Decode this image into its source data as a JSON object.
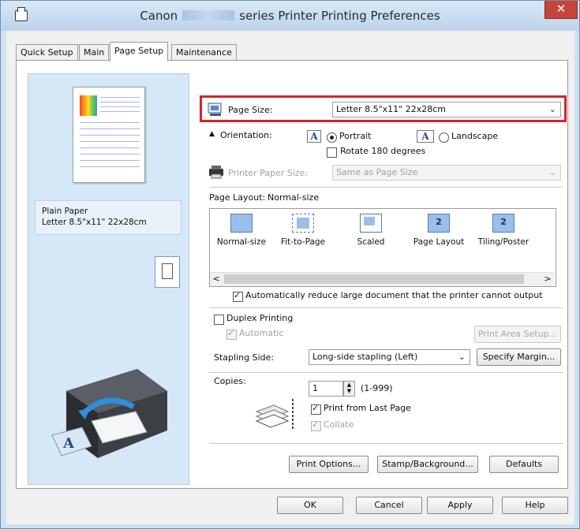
{
  "window": {
    "title_prefix": "Canon",
    "title_suffix": "series Printer Printing Preferences",
    "close_glyph": "✕"
  },
  "tabs": [
    {
      "label": "Quick Setup",
      "active": false
    },
    {
      "label": "Main",
      "active": false
    },
    {
      "label": "Page Setup",
      "active": true
    },
    {
      "label": "Maintenance",
      "active": false
    }
  ],
  "preview": {
    "media_type": "Plain Paper",
    "paper_size": "Letter 8.5\"x11\" 22x28cm"
  },
  "page_size": {
    "label": "Page Size:",
    "value": "Letter 8.5\"x11\" 22x28cm",
    "icon": "page-size-icon"
  },
  "orientation": {
    "label": "Orientation:",
    "icon_glyph": "A",
    "portrait_label": "Portrait",
    "landscape_label": "Landscape",
    "selected": "portrait",
    "rotate_label": "Rotate 180 degrees",
    "rotate_checked": false
  },
  "printer_paper_size": {
    "label": "Printer Paper Size:",
    "value": "Same as Page Size",
    "enabled": false
  },
  "page_layout": {
    "label": "Page Layout:",
    "current": "Normal-size",
    "options": [
      {
        "label": "Normal-size",
        "glyph": ""
      },
      {
        "label": "Fit-to-Page",
        "glyph": ""
      },
      {
        "label": "Scaled",
        "glyph": ""
      },
      {
        "label": "Page Layout",
        "glyph": "2"
      },
      {
        "label": "Tiling/Poster",
        "glyph": "2"
      }
    ],
    "scroll_left": "<",
    "scroll_right": ">"
  },
  "auto_reduce": {
    "label": "Automatically reduce large document that the printer cannot output",
    "checked": true
  },
  "duplex": {
    "label": "Duplex Printing",
    "checked": false,
    "automatic_label": "Automatic",
    "automatic_checked": true,
    "print_area_button": "Print Area Setup..."
  },
  "stapling": {
    "label": "Stapling Side:",
    "value": "Long-side stapling (Left)",
    "margin_button": "Specify Margin..."
  },
  "copies": {
    "label": "Copies:",
    "value": "1",
    "range": "(1-999)",
    "last_page_label": "Print from Last Page",
    "last_page_checked": true,
    "collate_label": "Collate",
    "collate_checked": true
  },
  "panel_buttons": {
    "print_options": "Print Options...",
    "stamp_background": "Stamp/Background...",
    "defaults": "Defaults"
  },
  "dialog_buttons": {
    "ok": "OK",
    "cancel": "Cancel",
    "apply": "Apply",
    "help": "Help"
  },
  "dropdown_arrow": "⌄",
  "highlight_color": "#d7222a"
}
